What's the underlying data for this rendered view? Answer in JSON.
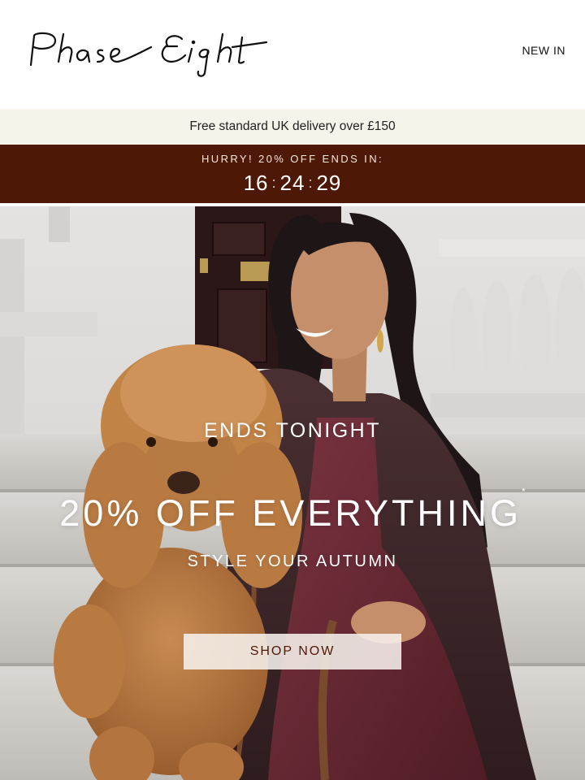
{
  "header": {
    "logo_text": "Phase Eight",
    "nav_new_in": "NEW IN"
  },
  "delivery_banner": {
    "text": "Free standard UK delivery over £150"
  },
  "countdown": {
    "label": "HURRY! 20% OFF ENDS IN:",
    "hours": "16",
    "minutes": "24",
    "seconds": "29",
    "separator": ":",
    "background_color": "#4e1807"
  },
  "hero": {
    "eyebrow": "ENDS TONIGHT",
    "headline": "20% OFF EVERYTHING",
    "headline_mark": "*",
    "subheadline": "STYLE YOUR AUTUMN",
    "cta_label": "SHOP NOW",
    "image_description_icon": "woman-with-poodle-photo"
  }
}
